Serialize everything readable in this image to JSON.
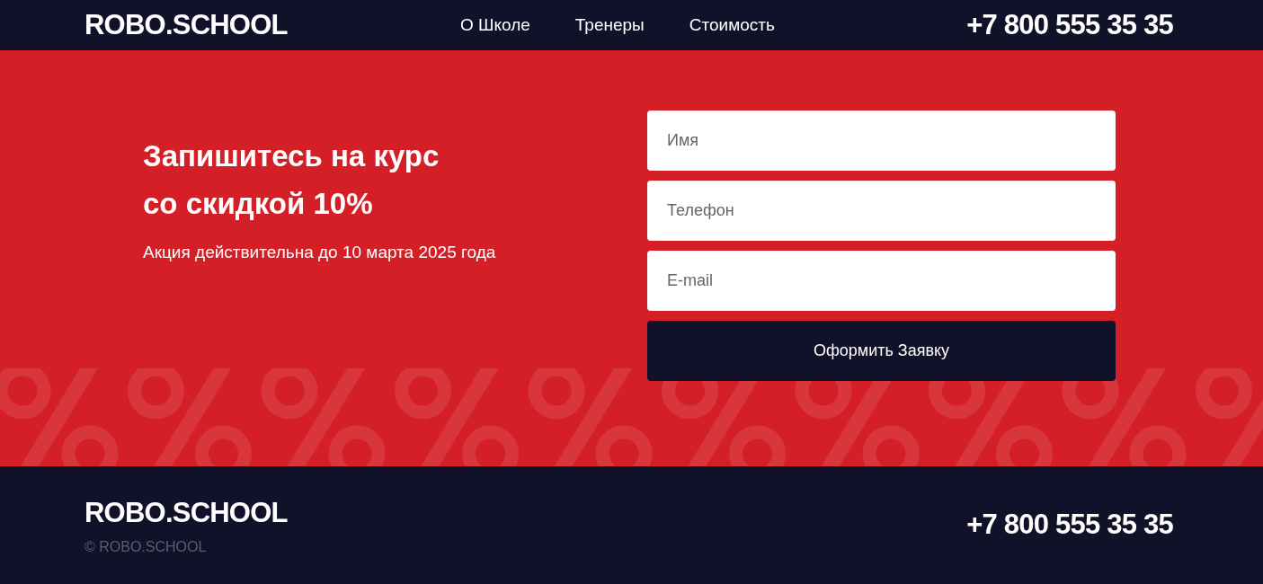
{
  "header": {
    "logo": "ROBO.SCHOOL",
    "nav": [
      "О Школе",
      "Тренеры",
      "Стоимость"
    ],
    "phone": "+7 800 555 35 35"
  },
  "promo": {
    "title_lines": [
      "Запишитесь на курс",
      "со скидкой 10%"
    ],
    "subtitle": "Акция действительна до 10 марта 2025 года"
  },
  "form": {
    "fields": [
      {
        "placeholder": "Имя"
      },
      {
        "placeholder": "Телефон"
      },
      {
        "placeholder": "E-mail"
      }
    ],
    "submit": "Оформить Заявку"
  },
  "footer": {
    "logo": "ROBO.SCHOOL",
    "copyright": "© ROBO.SCHOOL",
    "phone": "+7 800 555 35 35"
  }
}
